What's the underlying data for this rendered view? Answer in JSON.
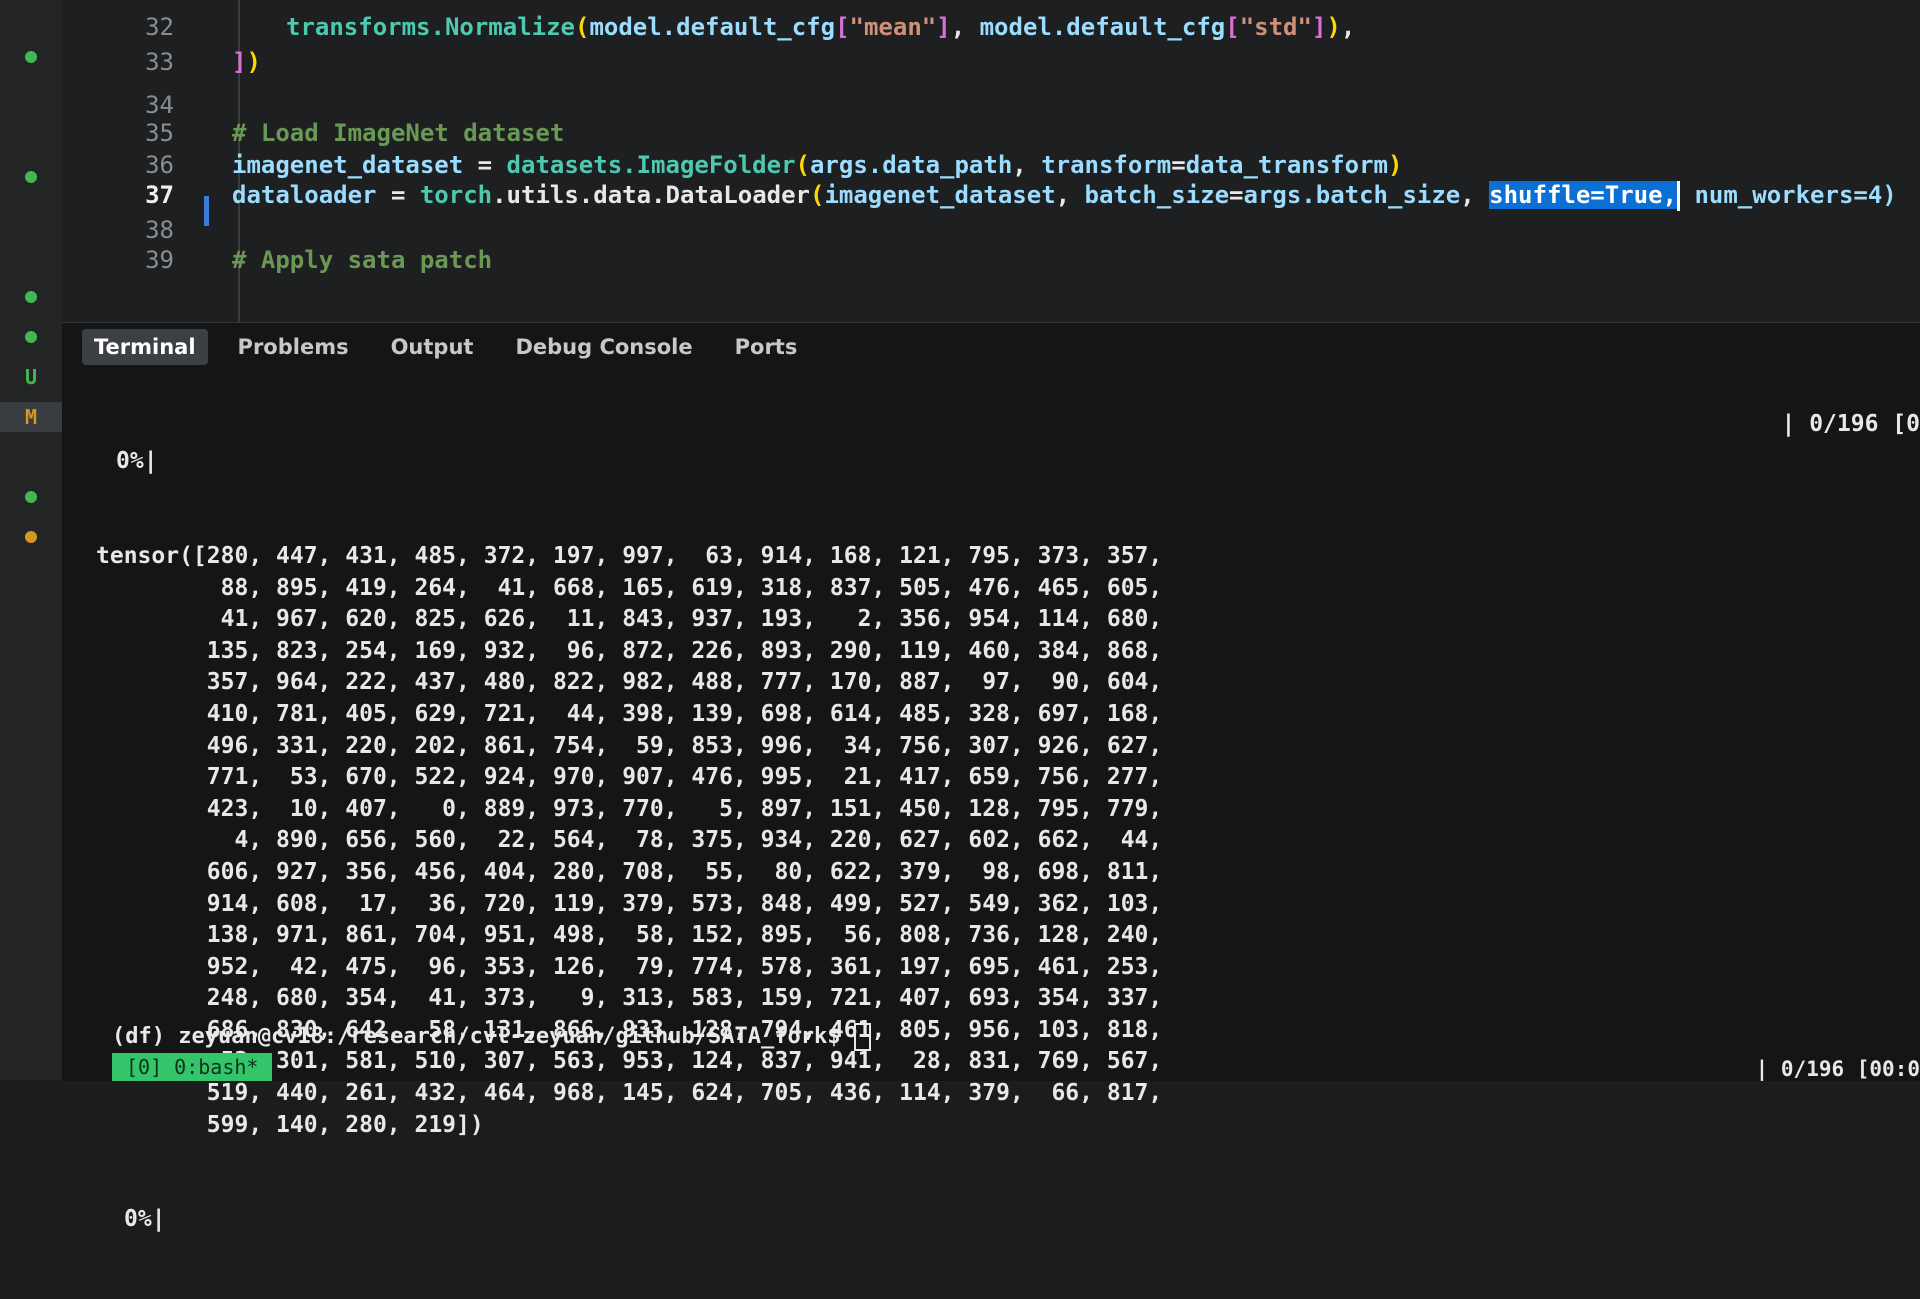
{
  "editor": {
    "lines": [
      {
        "num": "32",
        "parts": [
          [
            "fn",
            "transforms.Normalize"
          ],
          [
            "br1",
            "("
          ],
          [
            "var",
            "model.default_cfg"
          ],
          [
            "br2",
            "["
          ],
          [
            "str",
            "\"mean\""
          ],
          [
            "br2",
            "]"
          ],
          [
            "pun",
            ", "
          ],
          [
            "var",
            "model.default_cfg"
          ],
          [
            "br2",
            "["
          ],
          [
            "str",
            "\"std\""
          ],
          [
            "br2",
            "]"
          ],
          [
            "br1",
            ")"
          ],
          [
            "pun",
            ","
          ]
        ]
      },
      {
        "num": "33",
        "parts": [
          [
            "br2",
            "]"
          ],
          [
            "br1",
            ")"
          ]
        ]
      },
      {
        "num": "34",
        "parts": []
      },
      {
        "num": "35",
        "parts": [
          [
            "com",
            "# Load ImageNet dataset"
          ]
        ]
      },
      {
        "num": "36",
        "parts": [
          [
            "var",
            "imagenet_dataset"
          ],
          [
            "pun",
            " = "
          ],
          [
            "fn",
            "datasets.ImageFolder"
          ],
          [
            "br1",
            "("
          ],
          [
            "var",
            "args.data_path"
          ],
          [
            "pun",
            ", "
          ],
          [
            "var",
            "transform"
          ],
          [
            "pun",
            "="
          ],
          [
            "var",
            "data_transform"
          ],
          [
            "br1",
            ")"
          ]
        ]
      },
      {
        "num": "37",
        "parts": [
          [
            "var",
            "dataloader"
          ],
          [
            "pun",
            " = "
          ],
          [
            "fn",
            "torch"
          ],
          [
            "pun",
            ".utils.data.DataLoader"
          ],
          [
            "br1",
            "("
          ],
          [
            "var",
            "imagenet_dataset"
          ],
          [
            "pun",
            ", "
          ],
          [
            "var",
            "batch_size"
          ],
          [
            "pun",
            "="
          ],
          [
            "var",
            "args.batch_size"
          ],
          [
            "pun",
            ", "
          ]
        ],
        "selection": "shuffle=True,",
        "after": " num_workers=4)"
      },
      {
        "num": "38",
        "parts": []
      },
      {
        "num": "39",
        "parts": [
          [
            "com",
            "# Apply sata patch"
          ]
        ]
      }
    ]
  },
  "gutter": {
    "markers": [
      "",
      "",
      "",
      "",
      "",
      "U",
      "M",
      "",
      ""
    ],
    "u_label": "U",
    "m_label": "M",
    "dot_green": "#3fb950",
    "dot_orange": "#d29922"
  },
  "panel": {
    "tabs": [
      "Terminal",
      "Problems",
      "Output",
      "Debug Console",
      "Ports"
    ],
    "active_tab": "Terminal"
  },
  "terminal": {
    "progress_top": "0%|",
    "progress_right": "| 0/196 [0",
    "tensor_lines": [
      "tensor([280, 447, 431, 485, 372, 197, 997,  63, 914, 168, 121, 795, 373, 357,",
      "         88, 895, 419, 264,  41, 668, 165, 619, 318, 837, 505, 476, 465, 605,",
      "         41, 967, 620, 825, 626,  11, 843, 937, 193,   2, 356, 954, 114, 680,",
      "        135, 823, 254, 169, 932,  96, 872, 226, 893, 290, 119, 460, 384, 868,",
      "        357, 964, 222, 437, 480, 822, 982, 488, 777, 170, 887,  97,  90, 604,",
      "        410, 781, 405, 629, 721,  44, 398, 139, 698, 614, 485, 328, 697, 168,",
      "        496, 331, 220, 202, 861, 754,  59, 853, 996,  34, 756, 307, 926, 627,",
      "        771,  53, 670, 522, 924, 970, 907, 476, 995,  21, 417, 659, 756, 277,",
      "        423,  10, 407,   0, 889, 973, 770,   5, 897, 151, 450, 128, 795, 779,",
      "          4, 890, 656, 560,  22, 564,  78, 375, 934, 220, 627, 602, 662,  44,",
      "        606, 927, 356, 456, 404, 280, 708,  55,  80, 622, 379,  98, 698, 811,",
      "        914, 608,  17,  36, 720, 119, 379, 573, 848, 499, 527, 549, 362, 103,",
      "        138, 971, 861, 704, 951, 498,  58, 152, 895,  56, 808, 736, 128, 240,",
      "        952,  42, 475,  96, 353, 126,  79, 774, 578, 361, 197, 695, 461, 253,",
      "        248, 680, 354,  41, 373,   9, 313, 583, 159, 721, 407, 693, 354, 337,",
      "        686, 830, 642,  58, 131, 866, 933, 128, 794, 461, 805, 956, 103, 818,",
      "         52, 301, 581, 510, 307, 563, 953, 124, 837, 941,  28, 831, 769, 567,",
      "        519, 440, 261, 432, 464, 968, 145, 624, 705, 436, 114, 379,  66, 817,",
      "        599, 140, 280, 219])"
    ],
    "progress_bottom": "0%|",
    "prompt": "(df) zeyuan@cv18:/research/cvl-zeyuan/github/SATA_fork$ ",
    "tmux_status": "[0] 0:bash*",
    "bottom_right": "| 0/196 [00:0"
  }
}
